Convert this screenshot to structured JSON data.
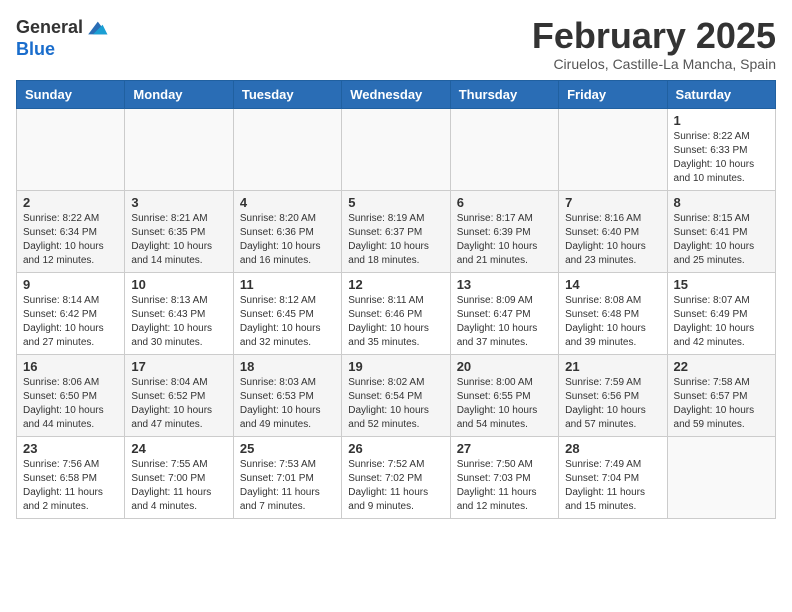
{
  "logo": {
    "general": "General",
    "blue": "Blue"
  },
  "title": "February 2025",
  "location": "Ciruelos, Castille-La Mancha, Spain",
  "days_of_week": [
    "Sunday",
    "Monday",
    "Tuesday",
    "Wednesday",
    "Thursday",
    "Friday",
    "Saturday"
  ],
  "weeks": [
    [
      {
        "day": "",
        "info": ""
      },
      {
        "day": "",
        "info": ""
      },
      {
        "day": "",
        "info": ""
      },
      {
        "day": "",
        "info": ""
      },
      {
        "day": "",
        "info": ""
      },
      {
        "day": "",
        "info": ""
      },
      {
        "day": "1",
        "info": "Sunrise: 8:22 AM\nSunset: 6:33 PM\nDaylight: 10 hours\nand 10 minutes."
      }
    ],
    [
      {
        "day": "2",
        "info": "Sunrise: 8:22 AM\nSunset: 6:34 PM\nDaylight: 10 hours\nand 12 minutes."
      },
      {
        "day": "3",
        "info": "Sunrise: 8:21 AM\nSunset: 6:35 PM\nDaylight: 10 hours\nand 14 minutes."
      },
      {
        "day": "4",
        "info": "Sunrise: 8:20 AM\nSunset: 6:36 PM\nDaylight: 10 hours\nand 16 minutes."
      },
      {
        "day": "5",
        "info": "Sunrise: 8:19 AM\nSunset: 6:37 PM\nDaylight: 10 hours\nand 18 minutes."
      },
      {
        "day": "6",
        "info": "Sunrise: 8:17 AM\nSunset: 6:39 PM\nDaylight: 10 hours\nand 21 minutes."
      },
      {
        "day": "7",
        "info": "Sunrise: 8:16 AM\nSunset: 6:40 PM\nDaylight: 10 hours\nand 23 minutes."
      },
      {
        "day": "8",
        "info": "Sunrise: 8:15 AM\nSunset: 6:41 PM\nDaylight: 10 hours\nand 25 minutes."
      }
    ],
    [
      {
        "day": "9",
        "info": "Sunrise: 8:14 AM\nSunset: 6:42 PM\nDaylight: 10 hours\nand 27 minutes."
      },
      {
        "day": "10",
        "info": "Sunrise: 8:13 AM\nSunset: 6:43 PM\nDaylight: 10 hours\nand 30 minutes."
      },
      {
        "day": "11",
        "info": "Sunrise: 8:12 AM\nSunset: 6:45 PM\nDaylight: 10 hours\nand 32 minutes."
      },
      {
        "day": "12",
        "info": "Sunrise: 8:11 AM\nSunset: 6:46 PM\nDaylight: 10 hours\nand 35 minutes."
      },
      {
        "day": "13",
        "info": "Sunrise: 8:09 AM\nSunset: 6:47 PM\nDaylight: 10 hours\nand 37 minutes."
      },
      {
        "day": "14",
        "info": "Sunrise: 8:08 AM\nSunset: 6:48 PM\nDaylight: 10 hours\nand 39 minutes."
      },
      {
        "day": "15",
        "info": "Sunrise: 8:07 AM\nSunset: 6:49 PM\nDaylight: 10 hours\nand 42 minutes."
      }
    ],
    [
      {
        "day": "16",
        "info": "Sunrise: 8:06 AM\nSunset: 6:50 PM\nDaylight: 10 hours\nand 44 minutes."
      },
      {
        "day": "17",
        "info": "Sunrise: 8:04 AM\nSunset: 6:52 PM\nDaylight: 10 hours\nand 47 minutes."
      },
      {
        "day": "18",
        "info": "Sunrise: 8:03 AM\nSunset: 6:53 PM\nDaylight: 10 hours\nand 49 minutes."
      },
      {
        "day": "19",
        "info": "Sunrise: 8:02 AM\nSunset: 6:54 PM\nDaylight: 10 hours\nand 52 minutes."
      },
      {
        "day": "20",
        "info": "Sunrise: 8:00 AM\nSunset: 6:55 PM\nDaylight: 10 hours\nand 54 minutes."
      },
      {
        "day": "21",
        "info": "Sunrise: 7:59 AM\nSunset: 6:56 PM\nDaylight: 10 hours\nand 57 minutes."
      },
      {
        "day": "22",
        "info": "Sunrise: 7:58 AM\nSunset: 6:57 PM\nDaylight: 10 hours\nand 59 minutes."
      }
    ],
    [
      {
        "day": "23",
        "info": "Sunrise: 7:56 AM\nSunset: 6:58 PM\nDaylight: 11 hours\nand 2 minutes."
      },
      {
        "day": "24",
        "info": "Sunrise: 7:55 AM\nSunset: 7:00 PM\nDaylight: 11 hours\nand 4 minutes."
      },
      {
        "day": "25",
        "info": "Sunrise: 7:53 AM\nSunset: 7:01 PM\nDaylight: 11 hours\nand 7 minutes."
      },
      {
        "day": "26",
        "info": "Sunrise: 7:52 AM\nSunset: 7:02 PM\nDaylight: 11 hours\nand 9 minutes."
      },
      {
        "day": "27",
        "info": "Sunrise: 7:50 AM\nSunset: 7:03 PM\nDaylight: 11 hours\nand 12 minutes."
      },
      {
        "day": "28",
        "info": "Sunrise: 7:49 AM\nSunset: 7:04 PM\nDaylight: 11 hours\nand 15 minutes."
      },
      {
        "day": "",
        "info": ""
      }
    ]
  ]
}
